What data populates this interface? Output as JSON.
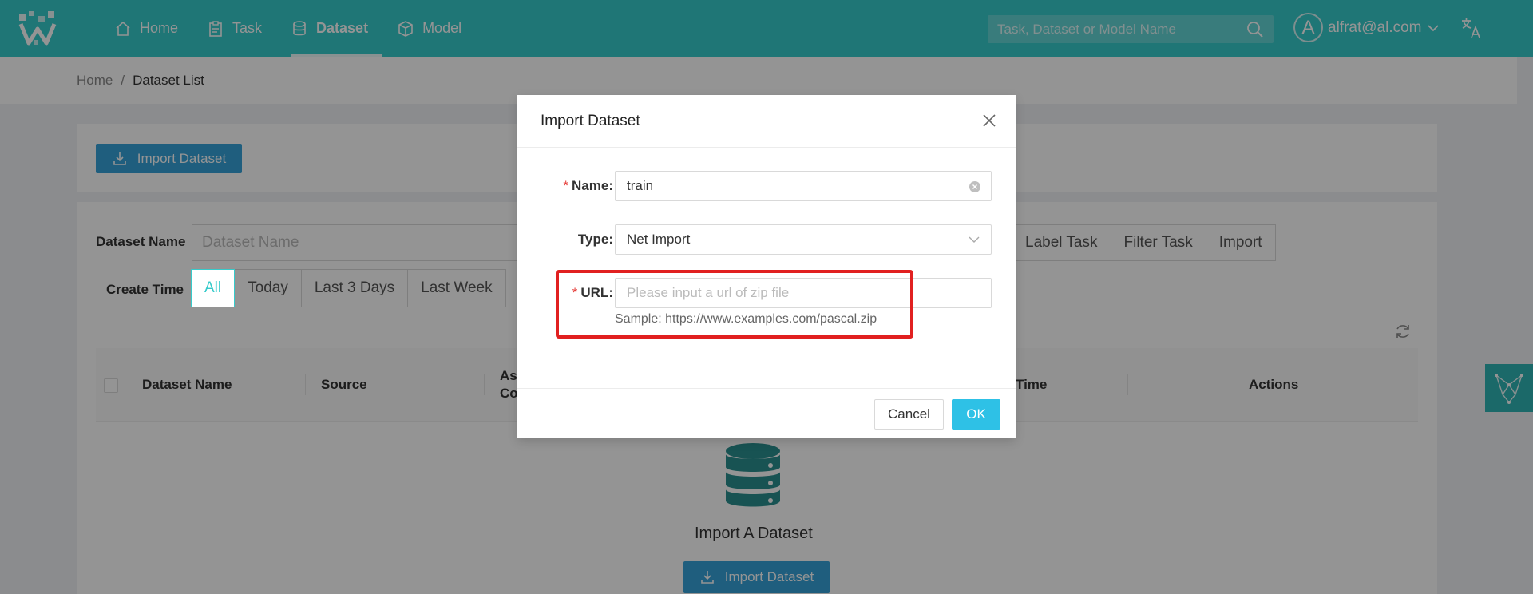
{
  "header": {
    "nav": [
      {
        "label": "Home",
        "icon": "home-icon"
      },
      {
        "label": "Task",
        "icon": "clipboard-icon"
      },
      {
        "label": "Dataset",
        "icon": "database-icon"
      },
      {
        "label": "Model",
        "icon": "cube-icon"
      }
    ],
    "active_nav": "Dataset",
    "search_placeholder": "Task, Dataset or Model Name",
    "avatar_letter": "A",
    "user_email": "alfrat@al.com"
  },
  "breadcrumb": {
    "home": "Home",
    "separator": "/",
    "current": "Dataset List"
  },
  "toolbar": {
    "import_label": "Import Dataset"
  },
  "filters": {
    "dataset_name_label": "Dataset Name",
    "dataset_name_placeholder": "Dataset Name",
    "source_options": [
      "Label Task",
      "Filter Task",
      "Import"
    ],
    "create_time_label": "Create Time",
    "time_options": [
      "All",
      "Today",
      "Last 3 Days",
      "Last Week"
    ],
    "time_selected": "All"
  },
  "table": {
    "columns": [
      "Dataset Name",
      "Source",
      "Ass Co",
      "Time",
      "Actions"
    ]
  },
  "empty_state": {
    "title": "Import A Dataset",
    "button_label": "Import Dataset"
  },
  "modal": {
    "title": "Import Dataset",
    "name_label": "Name",
    "name_value": "train",
    "type_label": "Type",
    "type_value": "Net Import",
    "url_label": "URL",
    "url_placeholder": "Please input a url of zip file",
    "url_help": "Sample: https://www.examples.com/pascal.zip",
    "cancel_label": "Cancel",
    "ok_label": "OK"
  },
  "colors": {
    "header": "#36cbcb",
    "primary_button": "#36a3d9",
    "ok_button": "#2ec1e6",
    "highlight_box": "#e12020",
    "required_mark": "#e53935"
  }
}
